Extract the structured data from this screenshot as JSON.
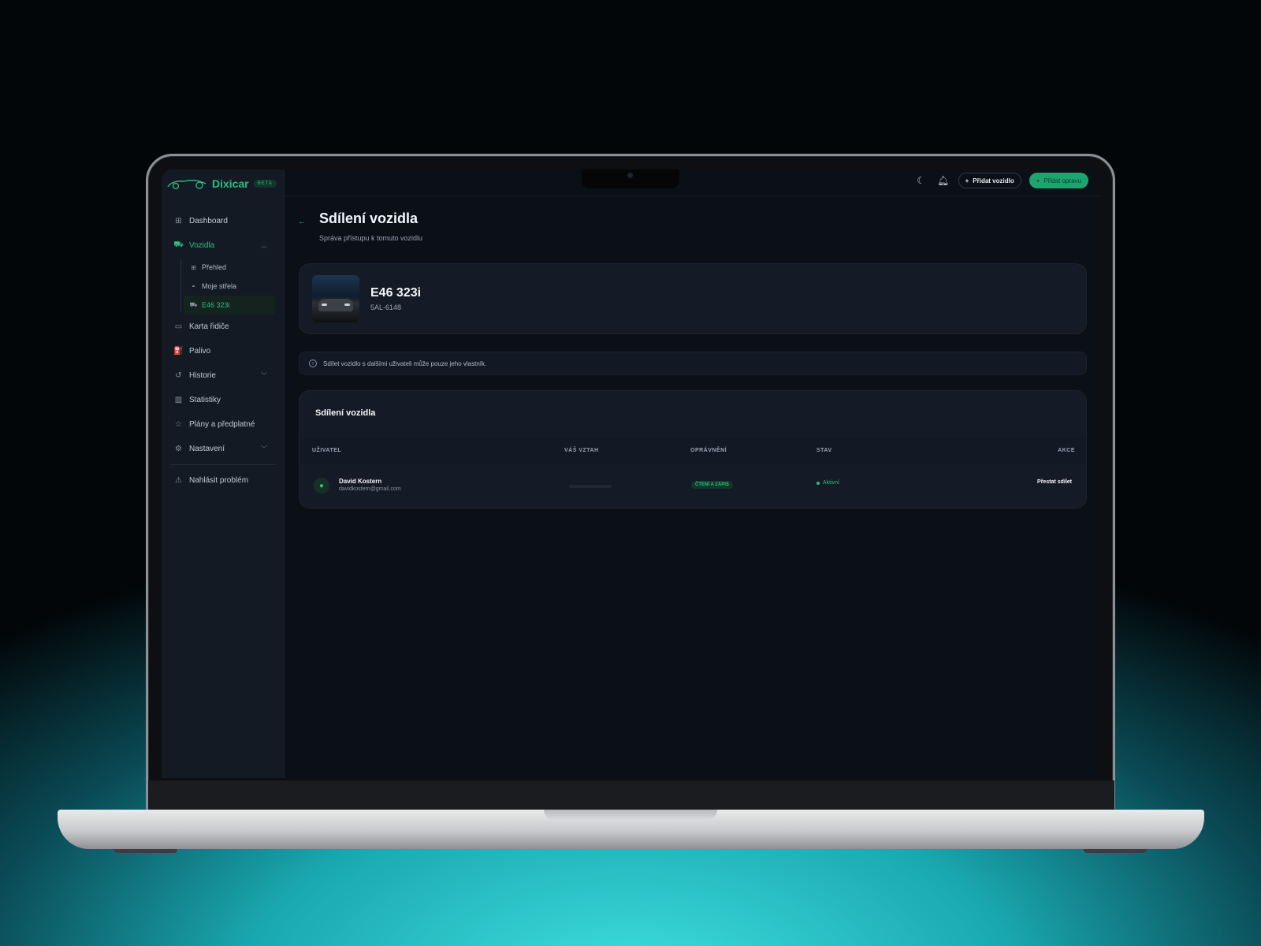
{
  "app": {
    "name": "Dixicar",
    "badge": "BETA"
  },
  "sidebar": {
    "items": [
      {
        "label": "Dashboard",
        "icon": "grid-icon"
      },
      {
        "label": "Vozidla",
        "icon": "car-icon",
        "active": true
      },
      {
        "label": "Karta řidiče",
        "icon": "id-card-icon"
      },
      {
        "label": "Palivo",
        "icon": "fuel-icon"
      },
      {
        "label": "Historie",
        "icon": "history-icon"
      },
      {
        "label": "Statistiky",
        "icon": "chart-icon"
      },
      {
        "label": "Plány a předplatné",
        "icon": "star-icon"
      },
      {
        "label": "Nastavení",
        "icon": "settings-icon"
      },
      {
        "label": "Nahlásit problém",
        "icon": "warning-icon"
      }
    ],
    "subitems": [
      {
        "label": "Přehled",
        "icon": "grid-icon"
      },
      {
        "label": "Moje střela",
        "icon": "car-icon"
      },
      {
        "label": "E46 323i",
        "icon": "car-icon",
        "current": true
      }
    ]
  },
  "topbar": {
    "add_vehicle": "Přidat vozidlo",
    "add_repair": "Přidat opravu"
  },
  "page": {
    "title": "Sdílení vozidla",
    "subtitle": "Správa přístupu k tomuto vozidlu"
  },
  "vehicle": {
    "name": "E46 323i",
    "plate": "5AL-6148"
  },
  "info": {
    "text": "Sdílet vozidlo s dalšími uživateli může pouze jeho vlastník."
  },
  "share": {
    "title": "Sdílení vozidla",
    "columns": [
      "UŽIVATEL",
      "VÁŠ VZTAH",
      "OPRÁVNĚNÍ",
      "STAV",
      "AKCE"
    ],
    "rows": [
      {
        "name": "David Kostern",
        "email": "davidkostern@gmail.com",
        "permission": "ČTENÍ A ZÁPIS",
        "status": "Aktivní",
        "action": "Přestat sdílet"
      }
    ]
  },
  "colors": {
    "accent": "#2bbf84",
    "background": "#0b0f16",
    "sidebar": "#141a24"
  }
}
